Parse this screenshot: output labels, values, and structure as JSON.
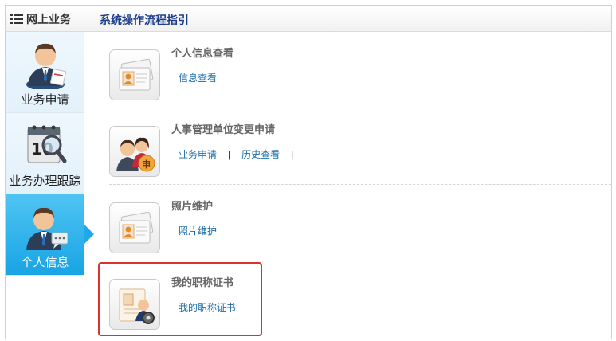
{
  "header": {
    "left_title": "网上业务",
    "guide_link": "系统操作流程指引"
  },
  "sidebar": {
    "items": [
      {
        "label": "业务申请",
        "icon": "business-apply-icon",
        "active": false
      },
      {
        "label": "业务办理跟踪",
        "icon": "calendar-magnifier-icon",
        "active": false
      },
      {
        "label": "个人信息",
        "icon": "person-chat-icon",
        "active": true
      }
    ]
  },
  "items": [
    {
      "title": "个人信息查看",
      "icon": "contact-card-icon",
      "links": [
        "信息查看"
      ]
    },
    {
      "title": "人事管理单位变更申请",
      "icon": "people-apply-badge-icon",
      "links": [
        "业务申请",
        "历史查看"
      ]
    },
    {
      "title": "照片维护",
      "icon": "contact-card-icon",
      "links": [
        "照片维护"
      ]
    },
    {
      "title": "我的职称证书",
      "icon": "certificate-gear-icon",
      "links": [
        "我的职称证书"
      ]
    }
  ],
  "colors": {
    "active_tab": "#1eaae8",
    "link": "#1a6ea8",
    "guide_link": "#1c3c8c",
    "highlight_border": "#d9342c"
  }
}
